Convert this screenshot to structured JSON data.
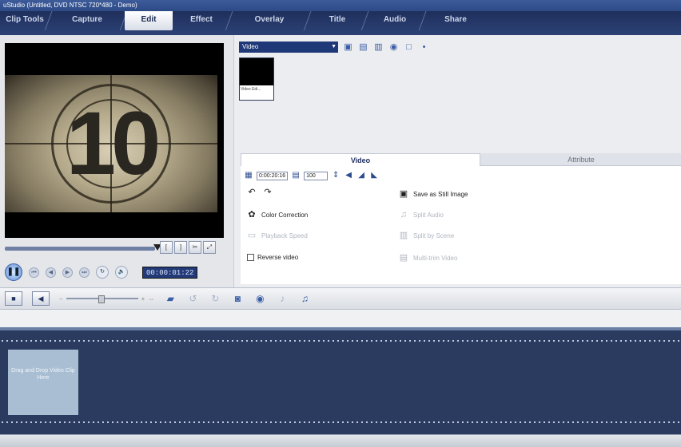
{
  "window": {
    "title": "uStudio (Untitled, DVD NTSC 720*480 - Demo)"
  },
  "tabs": [
    {
      "label": "Clip Tools",
      "active": false
    },
    {
      "label": "Capture",
      "active": false
    },
    {
      "label": "Edit",
      "active": true
    },
    {
      "label": "Effect",
      "active": false
    },
    {
      "label": "Overlay",
      "active": false
    },
    {
      "label": "Title",
      "active": false
    },
    {
      "label": "Audio",
      "active": false
    },
    {
      "label": "Share",
      "active": false
    }
  ],
  "preview": {
    "frame_number": "10",
    "timecode": "00:00:01:22"
  },
  "library": {
    "category": "Video",
    "thumbnail_label": "Video Edi..."
  },
  "options": {
    "tab_video": "Video",
    "tab_attribute": "Attribute",
    "duration": "0:00:20:16",
    "volume": "100",
    "save_still": "Save as Still Image",
    "color_correction": "Color Correction",
    "split_audio": "Split Audio",
    "playback_speed": "Playback Speed",
    "split_by_scene": "Split by Scene",
    "reverse_video": "Reverse video",
    "multi_trim": "Multi-trim Video"
  },
  "storyboard": {
    "drop_hint": "Drag and Drop Video Clip Here"
  },
  "colors": {
    "tabbar": "#1f2f5c",
    "storyboard": "#2b3b60",
    "accent": "#1f3878"
  }
}
